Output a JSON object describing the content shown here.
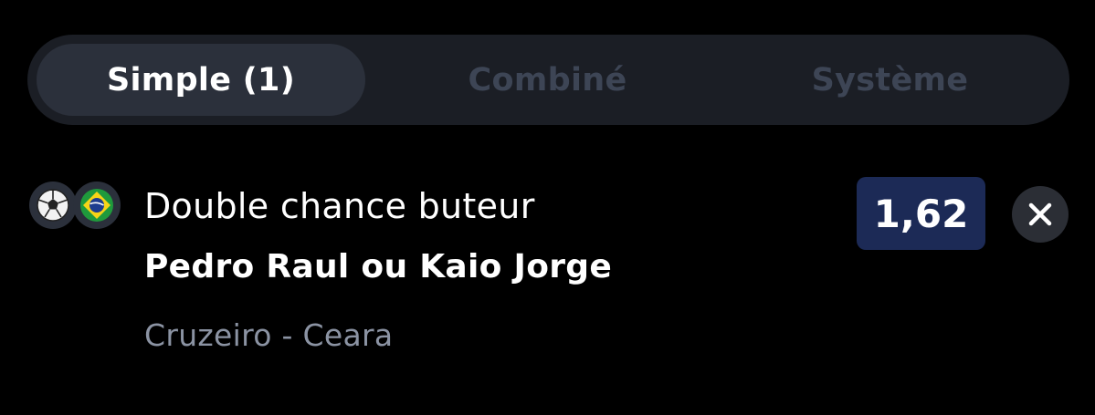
{
  "tabs": [
    {
      "label": "Simple (1)",
      "active": true
    },
    {
      "label": "Combiné",
      "active": false
    },
    {
      "label": "Système",
      "active": false
    }
  ],
  "bet": {
    "sport_icon": "soccer-ball-icon",
    "country_icon": "brazil-flag-icon",
    "market": "Double chance buteur",
    "selection": "Pedro Raul ou Kaio Jorge",
    "event": "Cruzeiro - Ceara",
    "odds": "1,62",
    "remove_icon": "close-icon"
  },
  "colors": {
    "background": "#000000",
    "tab_bar": "#1b1e25",
    "tab_active": "#2b303b",
    "tab_inactive_text": "#3d4555",
    "odds_badge": "#1c2a56",
    "secondary_text": "#8b93a3"
  }
}
